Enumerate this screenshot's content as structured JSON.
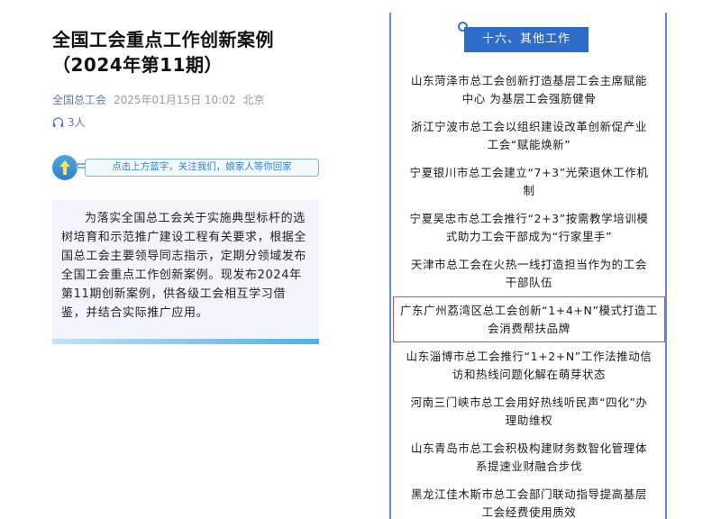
{
  "article": {
    "title": "全国工会重点工作创新案例（2024年第11期）",
    "source": "全国总工会",
    "datetime": "2025年01月15日 10:02",
    "location": "北京",
    "listeners": "3人"
  },
  "banner": {
    "text": "点击上方蓝字，关注我们，娘家人等你回家"
  },
  "intro": {
    "text": "为落实全国总工会关于实施典型标杆的选树培育和示范推广建设工程有关要求，根据全国总工会主要领导同志指示，定期分领域发布全国工会重点工作创新案例。现发布2024年第11期创新案例，供各级工会相互学习借鉴，并结合实际推广应用。"
  },
  "section": {
    "title": "十六、其他工作",
    "items": [
      "山东菏泽市总工会创新打造基层工会主席赋能中心 为基层工会强筋健骨",
      "浙江宁波市总工会以组织建设改革创新促产业工会“赋能焕新”",
      "宁夏银川市总工会建立“7+3”光荣退休工作机制",
      "宁夏吴忠市总工会推行“2+3”按需教学培训模式助力工会干部成为“行家里手”",
      "天津市总工会在火热一线打造担当作为的工会干部队伍",
      "广东广州荔湾区总工会创新“1+4+N”模式打造工会消费帮扶品牌",
      "山东淄博市总工会推行“1+2+N”工作法推动信访和热线问题化解在萌芽状态",
      "河南三门峡市总工会用好热线听民声“四化”办理助维权",
      "山东青岛市总工会积极构建财务数智化管理体系提速业财融合步伐",
      "黑龙江佳木斯市总工会部门联动指导提高基层工会经费使用质效"
    ],
    "highlighted_index": 5,
    "highlight_color": "#e04848",
    "accent_color": "#2d6cc7"
  }
}
